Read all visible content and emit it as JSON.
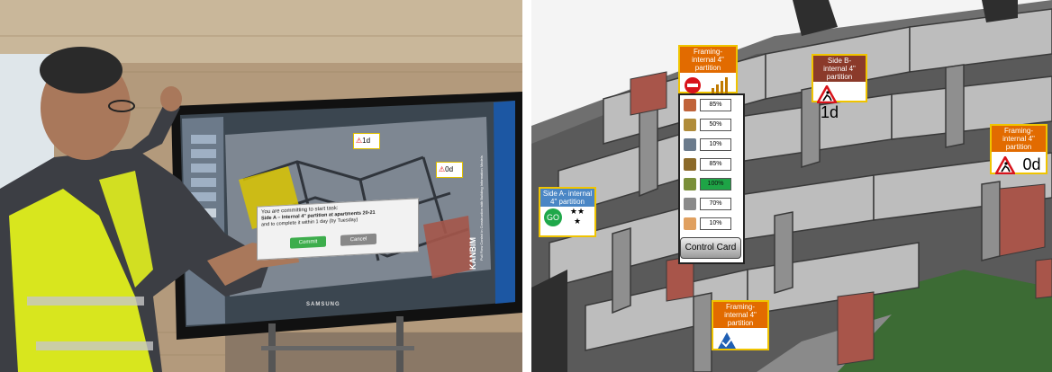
{
  "photo": {
    "dialog": {
      "line1": "You are committing to start task:",
      "line2": "Side A – Internal 4\" partition at apartments 20-21",
      "line3": "and to complete it within 1 day (by Tuesday)",
      "ok_label": "Commit",
      "cancel_label": "Cancel"
    },
    "screen_card_1d": "1d",
    "screen_card_0d": "0d",
    "brand": "KANBIM",
    "brand_sub": "Pull Flow Control in Construction with Building Information Models",
    "tv_brand": "SAMSUNG"
  },
  "bim": {
    "cards": {
      "top": {
        "title": "Framing-internal 4\" partition",
        "icon": "no-entry-icon",
        "icon2": "signal-bars-icon"
      },
      "side_b": {
        "title": "Side B- internal 4\" partition",
        "icon": "men-at-work-icon",
        "duration": "1d"
      },
      "right": {
        "title": "Framing-internal 4\" partition",
        "icon": "men-at-work-icon",
        "duration": "0d"
      },
      "side_a": {
        "title": "Side A- internal 4\" partition",
        "go": "GO",
        "stars": "★★\n★"
      },
      "bottom": {
        "title": "Framing-internal 4\" partition",
        "icon": "check-triangle-icon"
      }
    },
    "control_card": {
      "rows": [
        {
          "icon": "bricks-icon",
          "value": "85%",
          "highlight": false
        },
        {
          "icon": "barrier-icon",
          "value": "50%",
          "highlight": false
        },
        {
          "icon": "document-icon",
          "value": "10%",
          "highlight": false
        },
        {
          "icon": "materials-icon",
          "value": "85%",
          "highlight": false
        },
        {
          "icon": "crane-icon",
          "value": "100%",
          "highlight": true
        },
        {
          "icon": "tools-icon",
          "value": "70%",
          "highlight": false
        },
        {
          "icon": "worker-icon",
          "value": "10%",
          "highlight": false
        }
      ],
      "button_label": "Control Card"
    },
    "colors": {
      "orange": "#e26b00",
      "brown": "#8b3a2a",
      "blue": "#4a86c5",
      "go_green": "#1fa84a",
      "highlight_green": "#1ea446",
      "border_yellow": "#f0c400"
    }
  }
}
